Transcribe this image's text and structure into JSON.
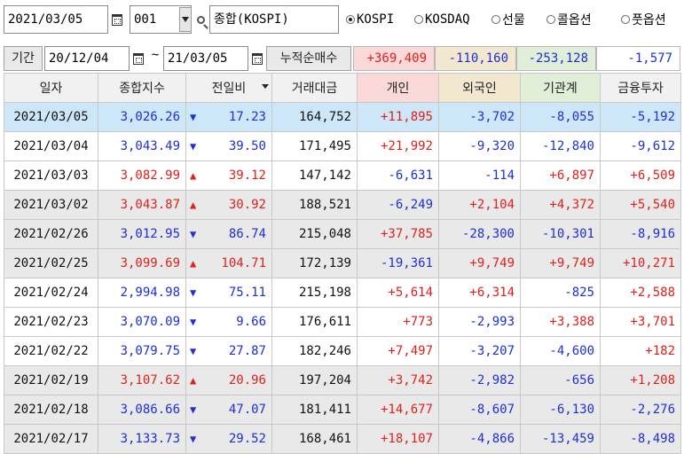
{
  "top": {
    "date": "2021/03/05",
    "code": "001",
    "name": "종합(KOSPI)",
    "markets": [
      {
        "label": "KOSPI",
        "selected": true
      },
      {
        "label": "KOSDAQ",
        "selected": false
      },
      {
        "label": "선물",
        "selected": false
      },
      {
        "label": "콜옵션",
        "selected": false
      },
      {
        "label": "풋옵션",
        "selected": false
      }
    ]
  },
  "period": {
    "label": "기간",
    "start": "20/12/04",
    "tilde": "~",
    "end": "21/03/05",
    "cum_label": "누적순매수",
    "sums": [
      "+369,409",
      "-110,160",
      "-253,128",
      "-1,577"
    ]
  },
  "colors": {
    "up": "#e0201c",
    "down": "#1d2fd6",
    "selected_row": "#cde7f8",
    "gray_row": "#e9e9e9",
    "indiv_hdr": "#fcd9d9",
    "foreign_hdr": "#f2e8d0",
    "inst_hdr": "#e2efd8"
  },
  "table": {
    "headers": [
      "일자",
      "종합지수",
      "전일비",
      "거래대금",
      "개인",
      "외국인",
      "기관계",
      "금융투자"
    ],
    "rows": [
      {
        "date": "2021/03/05",
        "index": "3,026.26",
        "dir": "down",
        "chg": "17.23",
        "amount": "164,752",
        "indiv": "+11,895",
        "foreign": "-3,702",
        "inst": "-8,055",
        "fin": "-5,192",
        "bg": "sel"
      },
      {
        "date": "2021/03/04",
        "index": "3,043.49",
        "dir": "down",
        "chg": "39.50",
        "amount": "171,495",
        "indiv": "+21,992",
        "foreign": "-9,320",
        "inst": "-12,840",
        "fin": "-9,612",
        "bg": "w"
      },
      {
        "date": "2021/03/03",
        "index": "3,082.99",
        "dir": "up",
        "chg": "39.12",
        "amount": "147,142",
        "indiv": "-6,631",
        "foreign": "-114",
        "inst": "+6,897",
        "fin": "+6,509",
        "bg": "w"
      },
      {
        "date": "2021/03/02",
        "index": "3,043.87",
        "dir": "up",
        "chg": "30.92",
        "amount": "188,521",
        "indiv": "-6,249",
        "foreign": "+2,104",
        "inst": "+4,372",
        "fin": "+5,540",
        "bg": "g"
      },
      {
        "date": "2021/02/26",
        "index": "3,012.95",
        "dir": "down",
        "chg": "86.74",
        "amount": "215,048",
        "indiv": "+37,785",
        "foreign": "-28,300",
        "inst": "-10,301",
        "fin": "-8,916",
        "bg": "g"
      },
      {
        "date": "2021/02/25",
        "index": "3,099.69",
        "dir": "up",
        "chg": "104.71",
        "amount": "172,139",
        "indiv": "-19,361",
        "foreign": "+9,749",
        "inst": "+9,749",
        "fin": "+10,271",
        "bg": "g"
      },
      {
        "date": "2021/02/24",
        "index": "2,994.98",
        "dir": "down",
        "chg": "75.11",
        "amount": "215,198",
        "indiv": "+5,614",
        "foreign": "+6,314",
        "inst": "-825",
        "fin": "+2,588",
        "bg": "w"
      },
      {
        "date": "2021/02/23",
        "index": "3,070.09",
        "dir": "down",
        "chg": "9.66",
        "amount": "176,611",
        "indiv": "+773",
        "foreign": "-2,993",
        "inst": "+3,388",
        "fin": "+3,701",
        "bg": "w"
      },
      {
        "date": "2021/02/22",
        "index": "3,079.75",
        "dir": "down",
        "chg": "27.87",
        "amount": "182,246",
        "indiv": "+7,497",
        "foreign": "-3,207",
        "inst": "-4,600",
        "fin": "+182",
        "bg": "w"
      },
      {
        "date": "2021/02/19",
        "index": "3,107.62",
        "dir": "up",
        "chg": "20.96",
        "amount": "197,204",
        "indiv": "+3,742",
        "foreign": "-2,982",
        "inst": "-656",
        "fin": "+1,208",
        "bg": "g"
      },
      {
        "date": "2021/02/18",
        "index": "3,086.66",
        "dir": "down",
        "chg": "47.07",
        "amount": "181,411",
        "indiv": "+14,677",
        "foreign": "-8,607",
        "inst": "-6,130",
        "fin": "-2,276",
        "bg": "g"
      },
      {
        "date": "2021/02/17",
        "index": "3,133.73",
        "dir": "down",
        "chg": "29.52",
        "amount": "168,461",
        "indiv": "+18,107",
        "foreign": "-4,866",
        "inst": "-13,459",
        "fin": "-8,498",
        "bg": "g"
      }
    ]
  }
}
